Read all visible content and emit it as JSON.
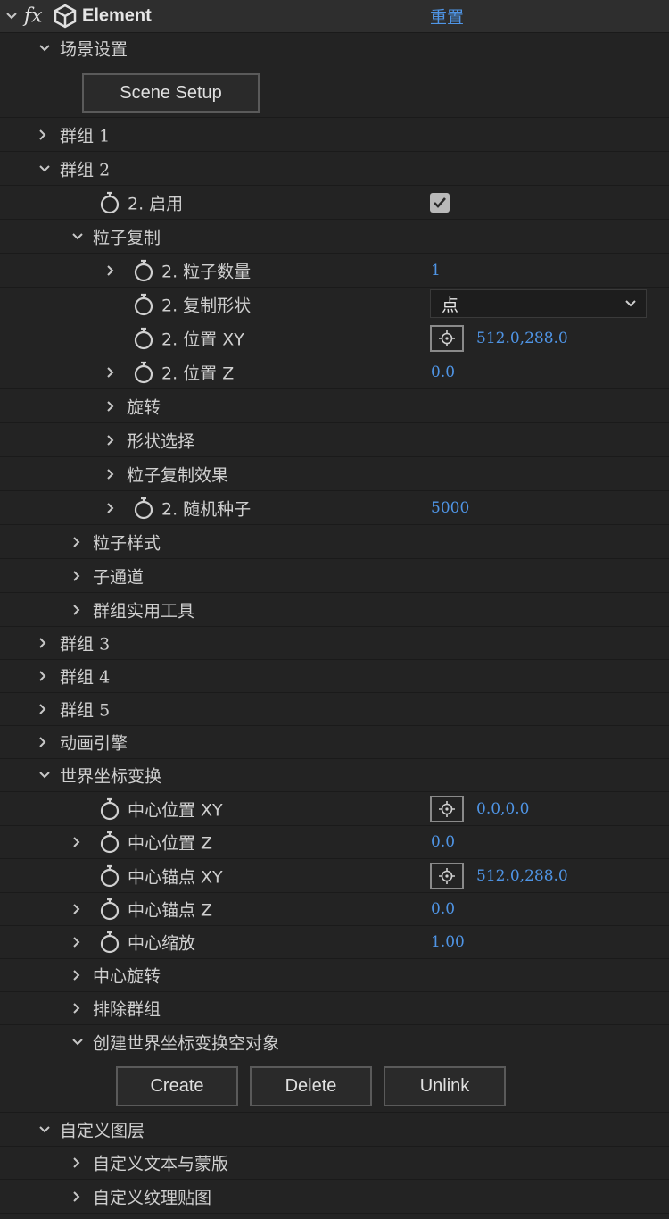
{
  "header": {
    "fx": "fx",
    "title": "Element",
    "reset": "重置"
  },
  "scene": {
    "label": "场景设置",
    "button": "Scene Setup"
  },
  "group1": {
    "label": "群组",
    "num": "1"
  },
  "group2": {
    "label": "群组",
    "num": "2",
    "enable": {
      "label": "2. 启用",
      "checked": true
    },
    "replicator": {
      "label": "粒子复制",
      "count": {
        "label": "2. 粒子数量",
        "value": "1"
      },
      "shape": {
        "label": "2. 复制形状",
        "value": "点"
      },
      "posxy": {
        "label": "2. 位置 XY",
        "value": "512.0,288.0"
      },
      "posz": {
        "label": "2. 位置 Z",
        "value": "0.0"
      },
      "rotation": "旋转",
      "shape_options": "形状选择",
      "effects": "粒子复制效果",
      "seed": {
        "label": "2. 随机种子",
        "value": "5000"
      }
    },
    "particle_look": "粒子样式",
    "subchannel": "子通道",
    "utilities": "群组实用工具"
  },
  "group3": {
    "label": "群组",
    "num": "3"
  },
  "group4": {
    "label": "群组",
    "num": "4"
  },
  "group5": {
    "label": "群组",
    "num": "5"
  },
  "animation_engine": "动画引擎",
  "world_transform": {
    "label": "世界坐标变换",
    "center_xy": {
      "label": "中心位置 XY",
      "value": "0.0,0.0"
    },
    "center_z": {
      "label": "中心位置 Z",
      "value": "0.0"
    },
    "anchor_xy": {
      "label": "中心锚点 XY",
      "value": "512.0,288.0"
    },
    "anchor_z": {
      "label": "中心锚点 Z",
      "value": "0.0"
    },
    "scale": {
      "label": "中心缩放",
      "value": "1.00"
    },
    "rotation": "中心旋转",
    "exclude": "排除群组",
    "create_null": {
      "label": "创建世界坐标变换空对象",
      "create": "Create",
      "delete": "Delete",
      "unlink": "Unlink"
    }
  },
  "custom_layers": {
    "label": "自定义图层",
    "text_masks": "自定义文本与蒙版",
    "texture_maps": "自定义纹理贴图"
  },
  "colors": {
    "bg": "#232323",
    "header_bg": "#2e2e2e",
    "accent_blue": "#4f95e6",
    "text": "#cfcfcf"
  },
  "icons": [
    "chevron-down-icon",
    "chevron-right-icon",
    "stopwatch-icon",
    "checkmark-icon",
    "crosshair-icon",
    "cube-icon",
    "fx-icon"
  ]
}
